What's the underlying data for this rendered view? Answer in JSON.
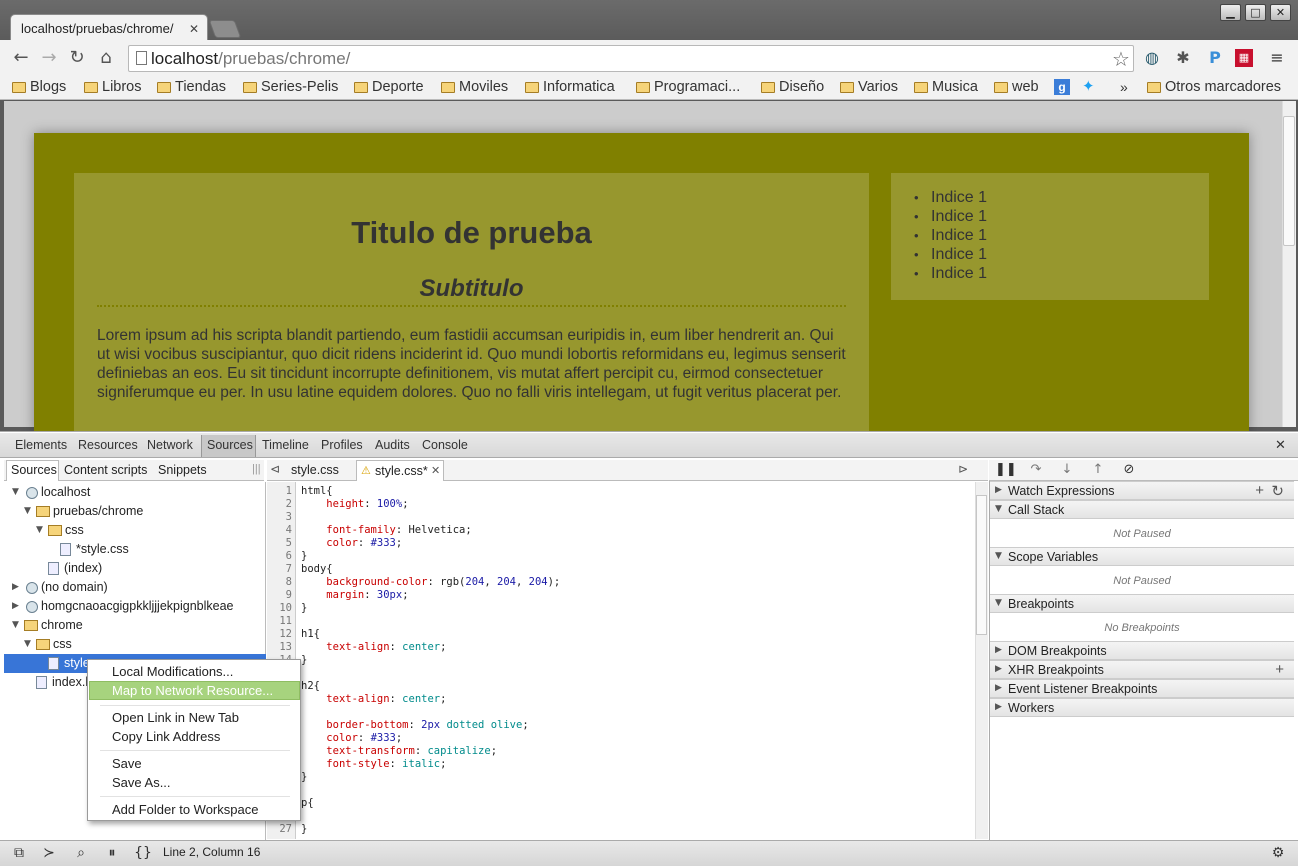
{
  "browser": {
    "tab_title": "localhost/pruebas/chrome/",
    "url_host": "localhost",
    "url_path": "/pruebas/chrome/",
    "window_buttons": [
      "▁",
      "□",
      "✕"
    ]
  },
  "bookmarks": [
    "Blogs",
    "Libros",
    "Tiendas",
    "Series-Pelis",
    "Deporte",
    "Moviles",
    "Informatica",
    "Programaci...",
    "Diseño",
    "Varios",
    "Musica",
    "web",
    "»",
    "Otros marcadores"
  ],
  "page": {
    "title": "Titulo de prueba",
    "subtitle": "Subtitulo",
    "paragraph": "Lorem ipsum ad his scripta blandit partiendo, eum fastidii accumsan euripidis in, eum liber hendrerit an. Qui ut wisi vocibus suscipiantur, quo dicit ridens inciderint id. Quo mundi lobortis reformidans eu, legimus senserit definiebas an eos. Eu sit tincidunt incorrupte definitionem, vis mutat affert percipit cu, eirmod consectetuer signiferumque eu per. In usu latine equidem dolores. Quo no falli viris intellegam, ut fugit veritus placerat per.",
    "list": [
      "Indice 1",
      "Indice 1",
      "Indice 1",
      "Indice 1",
      "Indice 1"
    ]
  },
  "devtools": {
    "tabs": [
      "Elements",
      "Resources",
      "Network",
      "Sources",
      "Timeline",
      "Profiles",
      "Audits",
      "Console"
    ],
    "active_tab": "Sources",
    "nav_tabs": [
      "Sources",
      "Content scripts",
      "Snippets"
    ],
    "tree": {
      "localhost": "localhost",
      "pruebas": "pruebas/chrome",
      "css1": "css",
      "stylecss": "*style.css",
      "index1": "(index)",
      "nodomain": "(no domain)",
      "ext": "homgcnaoacgigpkkljjjekpignblkeae",
      "chrome": "chrome",
      "css2": "css",
      "style_sel": "style",
      "index_html": "index.h"
    },
    "editor_tabs": [
      "style.css",
      "style.css*"
    ],
    "code_lines": [
      {
        "n": "1",
        "t": "html{"
      },
      {
        "n": "2",
        "t": "    height: 100%;"
      },
      {
        "n": "3",
        "t": ""
      },
      {
        "n": "4",
        "t": "    font-family: Helvetica;"
      },
      {
        "n": "5",
        "t": "    color: #333;"
      },
      {
        "n": "6",
        "t": "}"
      },
      {
        "n": "7",
        "t": "body{"
      },
      {
        "n": "8",
        "t": "    background-color: rgb(204, 204, 204);"
      },
      {
        "n": "9",
        "t": "    margin: 30px;"
      },
      {
        "n": "10",
        "t": "}"
      },
      {
        "n": "11",
        "t": ""
      },
      {
        "n": "12",
        "t": "h1{"
      },
      {
        "n": "13",
        "t": "    text-align: center;"
      },
      {
        "n": "14",
        "t": "}"
      },
      {
        "n": "",
        "t": ""
      },
      {
        "n": "",
        "t": "h2{"
      },
      {
        "n": "",
        "t": "    text-align: center;"
      },
      {
        "n": "",
        "t": ""
      },
      {
        "n": "",
        "t": "    border-bottom: 2px dotted olive;"
      },
      {
        "n": "",
        "t": "    color: #333;"
      },
      {
        "n": "",
        "t": "    text-transform: capitalize;"
      },
      {
        "n": "",
        "t": "    font-style: italic;"
      },
      {
        "n": "",
        "t": "}"
      },
      {
        "n": "",
        "t": ""
      },
      {
        "n": "",
        "t": "p{"
      },
      {
        "n": "",
        "t": ""
      },
      {
        "n": "27",
        "t": "}"
      }
    ],
    "sidebar": {
      "watch": "Watch Expressions",
      "callstack": "Call Stack",
      "not_paused": "Not Paused",
      "scope": "Scope Variables",
      "not_paused2": "Not Paused",
      "breakpoints": "Breakpoints",
      "no_breakpoints": "No Breakpoints",
      "dom_bp": "DOM Breakpoints",
      "xhr_bp": "XHR Breakpoints",
      "event_bp": "Event Listener Breakpoints",
      "workers": "Workers"
    },
    "status": "Line 2, Column 16"
  },
  "context_menu": {
    "local_mods": "Local Modifications...",
    "map_network": "Map to Network Resource...",
    "open_tab": "Open Link in New Tab",
    "copy_link": "Copy Link Address",
    "save": "Save",
    "save_as": "Save As...",
    "add_folder": "Add Folder to Workspace"
  }
}
